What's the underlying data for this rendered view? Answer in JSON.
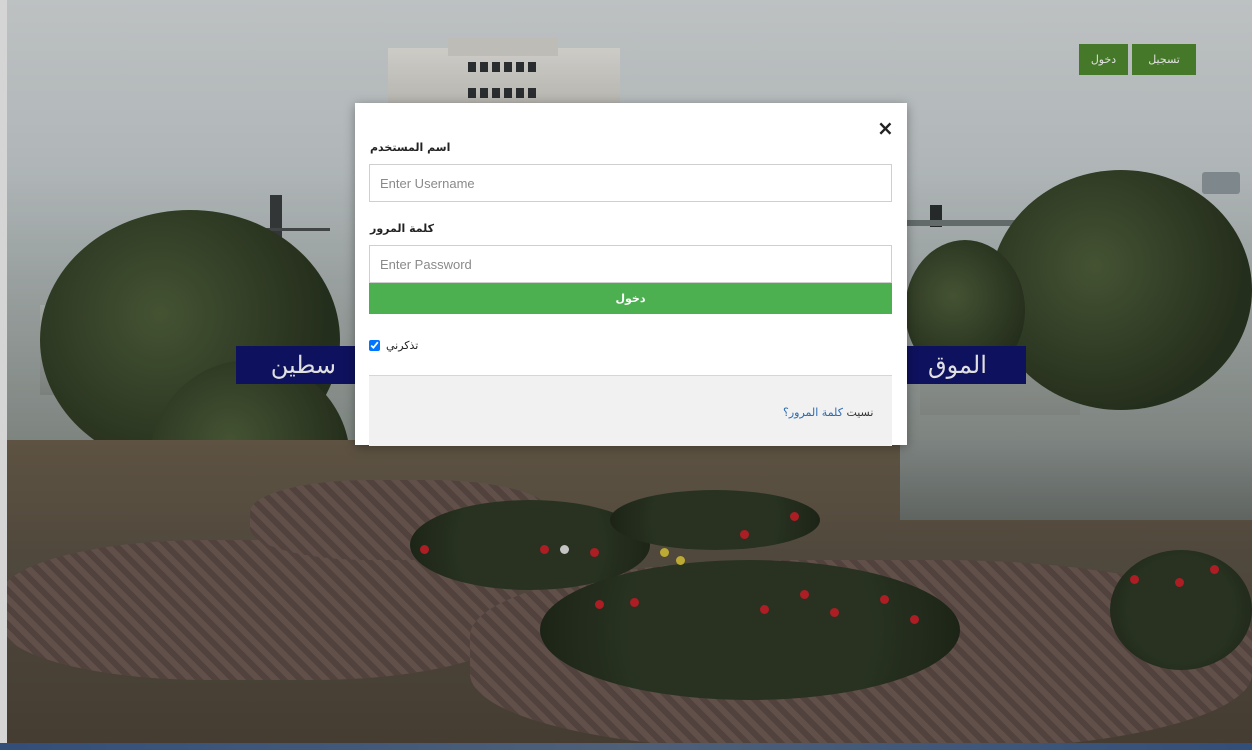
{
  "nav": {
    "login_label": "دخول",
    "register_label": "تسجيل",
    "button_color": "#4f8a2f"
  },
  "banner": {
    "left_text": "سطين",
    "right_text": "الموق",
    "color": "#10146a"
  },
  "modal": {
    "close_glyph": "×",
    "username_label": "اسم المستخدم",
    "username_placeholder": "Enter Username",
    "password_label": "كلمة المرور",
    "password_placeholder": "Enter Password",
    "submit_label": "دخول",
    "submit_color": "#4caf50",
    "remember_label": "تذكرني",
    "remember_checked": true,
    "forgot_prefix": "نسيت",
    "forgot_link": "كلمة المرور؟",
    "link_color": "#2a6ab0"
  }
}
